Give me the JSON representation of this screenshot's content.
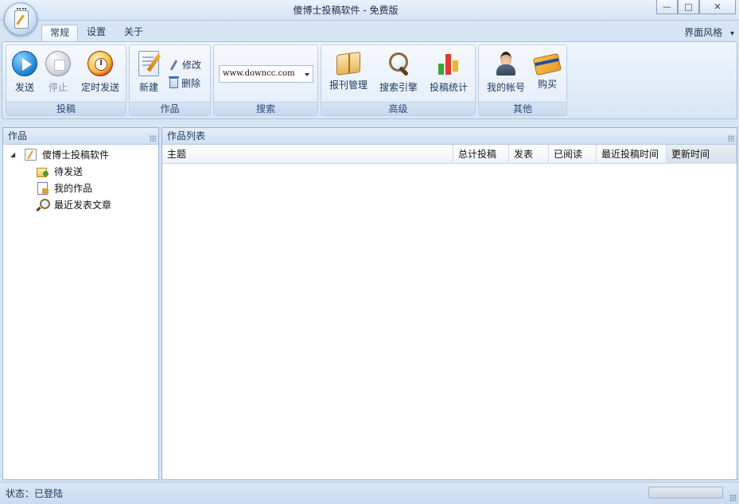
{
  "window": {
    "title": "傻博士投稿软件 - 免费版",
    "minimize_glyph": "—",
    "restore_glyph": "□",
    "close_glyph": "✕"
  },
  "ribbon": {
    "tabs": [
      {
        "label": "常规",
        "active": true
      },
      {
        "label": "设置",
        "active": false
      },
      {
        "label": "关于",
        "active": false
      }
    ],
    "skin_menu": "界面风格",
    "skin_menu_arrow": "▾",
    "groups": {
      "submit": {
        "label": "投稿",
        "send": "发送",
        "stop": "停止",
        "timed_send": "定时发送"
      },
      "works": {
        "label": "作品",
        "new": "新建",
        "edit": "修改",
        "delete": "删除"
      },
      "search": {
        "label": "搜索",
        "url_value": "www.downcc.com"
      },
      "advanced": {
        "label": "高级",
        "press_manage": "报刊管理",
        "search_engine": "搜索引擎",
        "stats": "投稿统计"
      },
      "other": {
        "label": "其他",
        "account": "我的帐号",
        "buy": "购买"
      }
    }
  },
  "left_pane": {
    "title": "作品",
    "tree": {
      "root": "傻博士投稿软件",
      "expander": "◢",
      "children": [
        "待发送",
        "我的作品",
        "最近发表文章"
      ]
    }
  },
  "right_pane": {
    "title": "作品列表",
    "columns": [
      "主题",
      "总计投稿",
      "发表",
      "已阅读",
      "最近投稿时间",
      "更新时间"
    ],
    "rows": []
  },
  "status": {
    "text": "状态：已登陆"
  },
  "icons": {
    "send": "play-icon",
    "stop": "stop-icon",
    "timed_send": "alarm-clock-icon",
    "new": "new-document-icon",
    "edit": "pencil-icon",
    "delete": "trash-icon",
    "press_manage": "book-icon",
    "search_engine": "magnifier-icon",
    "stats": "bar-chart-icon",
    "account": "user-icon",
    "buy": "credit-card-icon"
  },
  "colors": {
    "ribbon_border": "#a8c0de",
    "pane_border": "#98b3d6",
    "accent_blue": "#1c7fd0"
  }
}
